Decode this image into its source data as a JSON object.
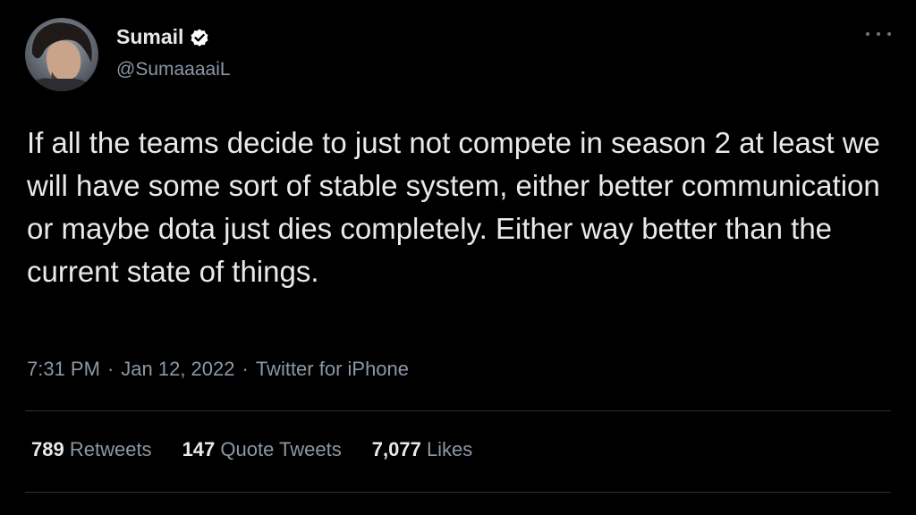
{
  "author": {
    "display_name": "Sumail",
    "handle": "@SumaaaaiL",
    "verified": true,
    "avatar_icon": "user-avatar"
  },
  "tweet": {
    "text": "If all the teams decide to just not compete in season 2 at least we will have some sort of stable system, either better communication or maybe dota just dies completely. Either way better than the current state of things."
  },
  "meta": {
    "time": "7:31 PM",
    "separator": "·",
    "date": "Jan 12, 2022",
    "source": "Twitter for iPhone"
  },
  "stats": {
    "retweets_count": "789",
    "retweets_label": "Retweets",
    "quotes_count": "147",
    "quotes_label": "Quote Tweets",
    "likes_count": "7,077",
    "likes_label": "Likes"
  },
  "colors": {
    "background": "#000000",
    "primary_text": "#e7e9ea",
    "secondary_text": "#8b98a5",
    "divider": "#2f3336",
    "verified_badge": "#ffffff"
  }
}
